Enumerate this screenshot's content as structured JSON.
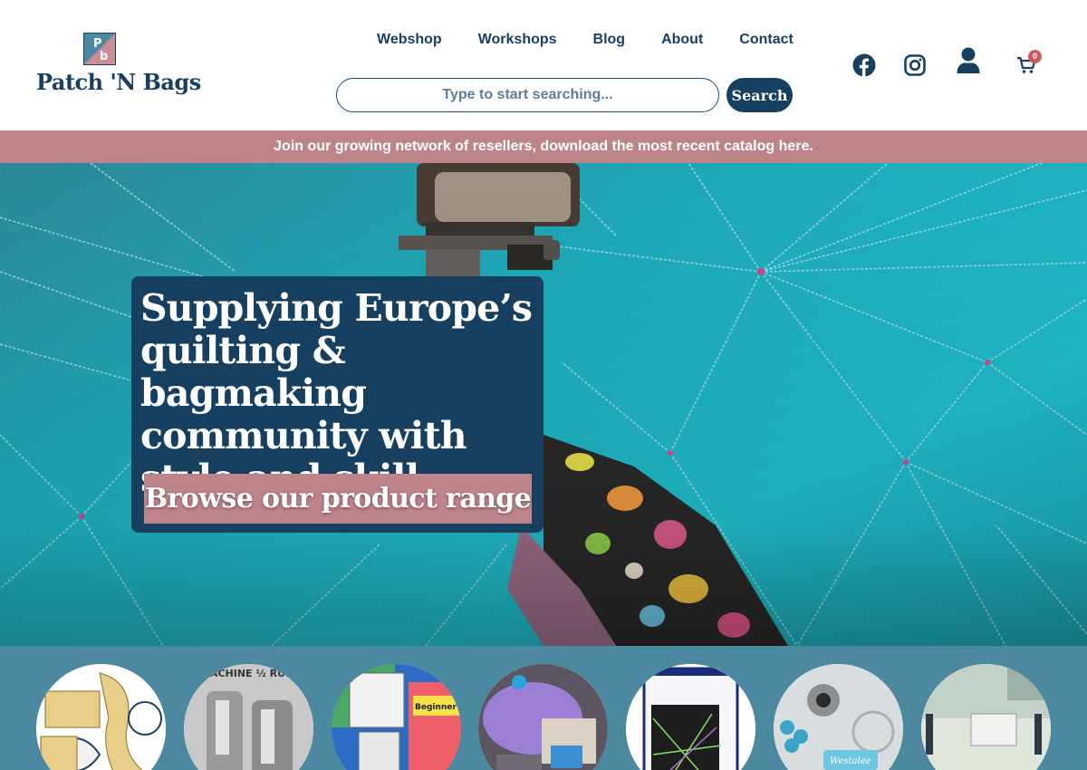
{
  "brand": {
    "name": "Patch 'N Bags",
    "logo_letters": "PNB"
  },
  "nav": {
    "items": [
      "Webshop",
      "Workshops",
      "Blog",
      "About",
      "Contact"
    ]
  },
  "search": {
    "placeholder": "Type to start searching...",
    "button_label": "Search"
  },
  "cart": {
    "count": "0"
  },
  "icons": {
    "social": [
      "facebook-icon",
      "instagram-icon"
    ],
    "account": "user-icon",
    "cart": "cart-icon"
  },
  "announcement": {
    "text": "Join our growing network of resellers, download the most recent catalog here."
  },
  "hero": {
    "title": "Supplying Europe’s quilting & bagmaking community with style and skill.",
    "cta_label": "Browse our product range"
  },
  "categories": {
    "images": [
      "quilting-rulers-image",
      "machine-half-rulers-image",
      "beginner-templates-image",
      "longarm-accessories-image",
      "quilting-pattern-book-image",
      "ruler-foot-kit-image",
      "sewing-machine-table-image"
    ]
  },
  "colors": {
    "navy": "#173f5f",
    "rose": "#bd848a",
    "teal_fabric": "#22b2c2",
    "strip_blue": "#4d88a1",
    "badge_red": "#cc5c5c"
  }
}
